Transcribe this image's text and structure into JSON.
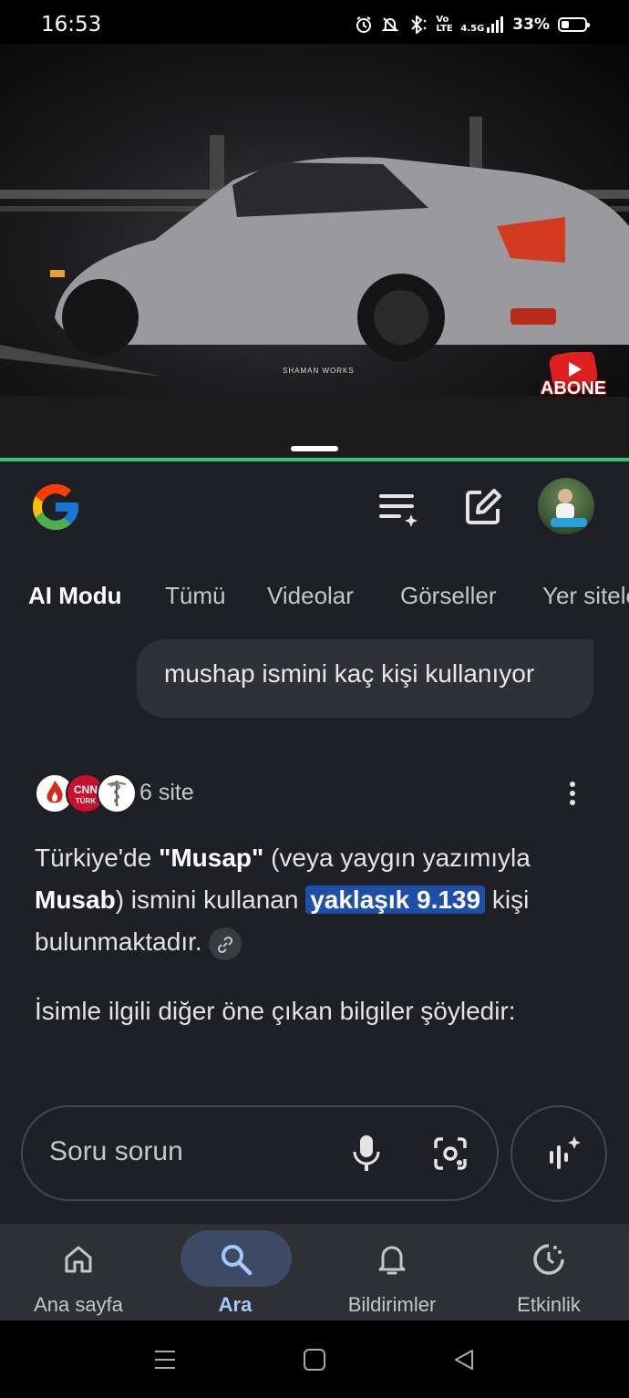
{
  "status_bar": {
    "time": "16:53",
    "network": "4.5G",
    "volte": "Vo LTE",
    "battery": "33%",
    "battery_level": 0.33,
    "icons": [
      "alarm-icon",
      "bell-off-icon",
      "bluetooth-icon",
      "volte-icon",
      "signal-icon",
      "battery-icon"
    ]
  },
  "video": {
    "watermark": "SHAMAN WORKS",
    "badge": "ABONE OL"
  },
  "header": {
    "logo": "google-g-logo",
    "icons": [
      "history-list-icon",
      "new-chat-icon",
      "avatar"
    ]
  },
  "tabs": [
    "AI Modu",
    "Tümü",
    "Videolar",
    "Görseller",
    "Yer siteleri"
  ],
  "query": "mushap ismini kaç kişi kullanıyor",
  "sources": {
    "count_label": "6 site",
    "icons": [
      "flame-logo",
      "cnn-turk-logo",
      "medical-logo"
    ]
  },
  "answer": {
    "p1_a": "Türkiye'de ",
    "p1_b": "\"Musap\"",
    "p1_c": " (veya yaygın yazımıyla ",
    "p1_d": "Musab",
    "p1_e": ") ismini kullanan ",
    "p1_highlight": "yaklaşık 9.139",
    "p1_f": " kişi bulunmaktadır.",
    "p2": "İsimle ilgili diğer öne çıkan bilgiler şöyledir:"
  },
  "ask": {
    "placeholder": "Soru sorun"
  },
  "bottom_nav": [
    {
      "label": "Ana sayfa",
      "icon": "home-icon"
    },
    {
      "label": "Ara",
      "icon": "search-icon",
      "active": true
    },
    {
      "label": "Bildirimler",
      "icon": "bell-icon"
    },
    {
      "label": "Etkinlik",
      "icon": "activity-icon"
    }
  ],
  "colors": {
    "background": "#1f2025",
    "highlight": "#1d4ea8",
    "active_nav": "#a8c7fa",
    "divider": "#3ec46a"
  }
}
